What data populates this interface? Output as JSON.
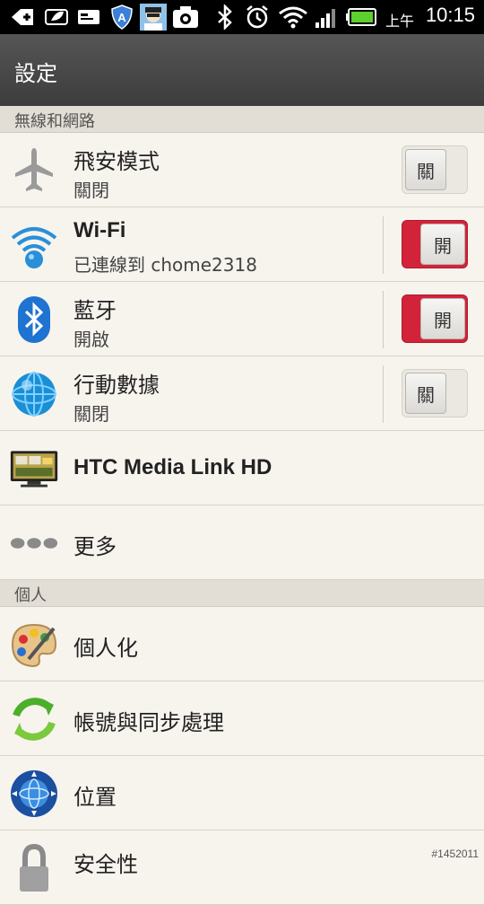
{
  "status_bar": {
    "ampm": "上午",
    "time": "10:15",
    "icons": [
      "back-plus-icon",
      "leaf-icon",
      "card-icon",
      "shield-a-icon",
      "avatar-icon",
      "camera-icon",
      "bluetooth-icon",
      "alarm-icon",
      "wifi-icon",
      "signal-icon",
      "battery-icon"
    ]
  },
  "header": {
    "title": "設定"
  },
  "sections": {
    "wireless": {
      "title": "無線和網路"
    },
    "personal": {
      "title": "個人"
    }
  },
  "rows": {
    "airplane": {
      "label": "飛安模式",
      "sub": "關閉",
      "toggle": "關",
      "icon": "airplane-icon"
    },
    "wifi": {
      "label": "Wi-Fi",
      "sub": "已連線到 chome2318",
      "toggle": "開",
      "icon": "wifi-icon"
    },
    "bluetooth": {
      "label": "藍牙",
      "sub": "開啟",
      "toggle": "開",
      "icon": "bluetooth-icon"
    },
    "mobile_data": {
      "label": "行動數據",
      "sub": "關閉",
      "toggle": "關",
      "icon": "globe-icon"
    },
    "media_link": {
      "label": "HTC Media Link HD",
      "icon": "tv-icon"
    },
    "more": {
      "label": "更多",
      "icon": "more-dots-icon"
    },
    "personalize": {
      "label": "個人化",
      "icon": "palette-icon"
    },
    "accounts_sync": {
      "label": "帳號與同步處理",
      "icon": "sync-icon"
    },
    "location": {
      "label": "位置",
      "icon": "location-globe-icon"
    },
    "security": {
      "label": "安全性",
      "icon": "lock-icon"
    }
  },
  "watermark": "#1452011",
  "colors": {
    "toggle_on": "#d3233a",
    "title_bar": "#454545",
    "background": "#f4f1ea"
  }
}
